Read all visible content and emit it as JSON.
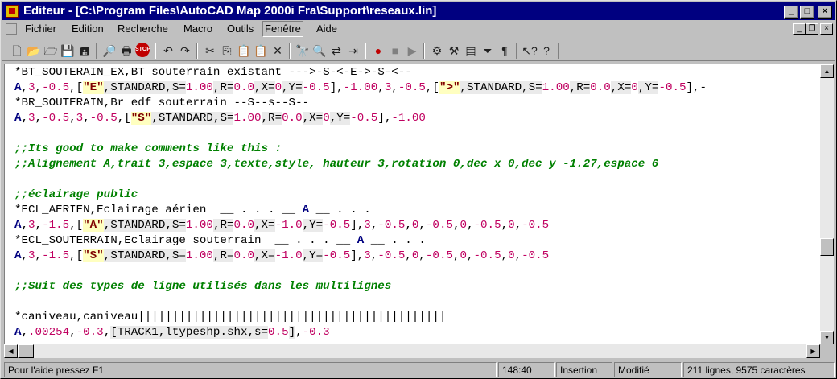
{
  "window": {
    "title": "Editeur - [C:\\Program Files\\AutoCAD Map 2000i Fra\\Support\\reseaux.lin]",
    "minimize": "_",
    "maximize": "□",
    "close": "×"
  },
  "menu": [
    "Fichier",
    "Edition",
    "Recherche",
    "Macro",
    "Outils",
    "Fenêtre",
    "Aide"
  ],
  "mdi": {
    "minimize": "_",
    "restore": "❐",
    "close": "×"
  },
  "toolbar": [
    {
      "name": "new-icon",
      "glyph": "🗋"
    },
    {
      "name": "open-icon",
      "glyph": "📂"
    },
    {
      "name": "open-folder-icon",
      "glyph": "🗁"
    },
    {
      "name": "save-icon",
      "glyph": "💾"
    },
    {
      "name": "save-all-icon",
      "glyph": "🖪"
    },
    {
      "name": "find-file-icon",
      "glyph": "🔎"
    },
    {
      "name": "print-icon",
      "glyph": "🖶"
    },
    {
      "name": "stop-icon",
      "glyph": "STOP"
    },
    {
      "name": "undo-icon",
      "glyph": "↶"
    },
    {
      "name": "redo-icon",
      "glyph": "↷"
    },
    {
      "name": "cut-icon",
      "glyph": "✂"
    },
    {
      "name": "copy-icon",
      "glyph": "⎘"
    },
    {
      "name": "paste-icon",
      "glyph": "📋"
    },
    {
      "name": "paste-special-icon",
      "glyph": "📋"
    },
    {
      "name": "delete-icon",
      "glyph": "✕"
    },
    {
      "name": "find-icon",
      "glyph": "🔭"
    },
    {
      "name": "find-next-icon",
      "glyph": "🔍"
    },
    {
      "name": "replace-icon",
      "glyph": "⇄"
    },
    {
      "name": "goto-icon",
      "glyph": "⇥"
    },
    {
      "name": "record-icon",
      "glyph": "●"
    },
    {
      "name": "stop-record-icon",
      "glyph": "■"
    },
    {
      "name": "play-icon",
      "glyph": "▶"
    },
    {
      "name": "macro-icon",
      "glyph": "⚙"
    },
    {
      "name": "tools-icon",
      "glyph": "⚒"
    },
    {
      "name": "window-icon",
      "glyph": "▤"
    },
    {
      "name": "filter-icon",
      "glyph": "⏷"
    },
    {
      "name": "paragraph-icon",
      "glyph": "¶"
    },
    {
      "name": "context-help-icon",
      "glyph": "↖?"
    },
    {
      "name": "help-icon",
      "glyph": "?"
    }
  ],
  "editor": {
    "lines": [
      [
        [
          "p",
          "*BT_SOUTERAIN_EX,BT souterrain existant --->-S-<-E->-S-<--"
        ]
      ],
      [
        [
          "k",
          "A"
        ],
        [
          "p",
          ","
        ],
        [
          "n",
          "3"
        ],
        [
          "p",
          ","
        ],
        [
          "n",
          "-0.5"
        ],
        [
          "p",
          ",["
        ],
        [
          "s",
          "\"E\""
        ],
        [
          "g",
          ",STANDARD,S="
        ],
        [
          "n",
          "1.00"
        ],
        [
          "g",
          ",R="
        ],
        [
          "n",
          "0.0"
        ],
        [
          "g",
          ",X="
        ],
        [
          "n",
          "0"
        ],
        [
          "g",
          ",Y="
        ],
        [
          "n",
          "-0.5"
        ],
        [
          "p",
          "],"
        ],
        [
          "n",
          "-1.00"
        ],
        [
          "p",
          ","
        ],
        [
          "n",
          "3"
        ],
        [
          "p",
          ","
        ],
        [
          "n",
          "-0.5"
        ],
        [
          "p",
          ",["
        ],
        [
          "s",
          "\">\""
        ],
        [
          "g",
          ",STANDARD,S="
        ],
        [
          "n",
          "1.00"
        ],
        [
          "g",
          ",R="
        ],
        [
          "n",
          "0.0"
        ],
        [
          "g",
          ",X="
        ],
        [
          "n",
          "0"
        ],
        [
          "g",
          ",Y="
        ],
        [
          "n",
          "-0.5"
        ],
        [
          "p",
          "],-"
        ]
      ],
      [
        [
          "p",
          "*BR_SOUTERAIN,Br edf souterrain --S--s--S--"
        ]
      ],
      [
        [
          "k",
          "A"
        ],
        [
          "p",
          ","
        ],
        [
          "n",
          "3"
        ],
        [
          "p",
          ","
        ],
        [
          "n",
          "-0.5"
        ],
        [
          "p",
          ","
        ],
        [
          "n",
          "3"
        ],
        [
          "p",
          ","
        ],
        [
          "n",
          "-0.5"
        ],
        [
          "p",
          ",["
        ],
        [
          "s",
          "\"S\""
        ],
        [
          "g",
          ",STANDARD,S="
        ],
        [
          "n",
          "1.00"
        ],
        [
          "g",
          ",R="
        ],
        [
          "n",
          "0.0"
        ],
        [
          "g",
          ",X="
        ],
        [
          "n",
          "0"
        ],
        [
          "g",
          ",Y="
        ],
        [
          "n",
          "-0.5"
        ],
        [
          "p",
          "],"
        ],
        [
          "n",
          "-1.00"
        ]
      ],
      [
        [
          "p",
          ""
        ]
      ],
      [
        [
          "c",
          ";;Its good to make comments like this :"
        ]
      ],
      [
        [
          "c",
          ";;Alignement A,trait 3,espace 3,texte,style, hauteur 3,rotation 0,dec x 0,dec y -1.27,espace 6"
        ]
      ],
      [
        [
          "p",
          ""
        ]
      ],
      [
        [
          "c",
          ";;éclairage public"
        ]
      ],
      [
        [
          "p",
          "*ECL_AERIEN,Eclairage aérien  __ . . . __ "
        ],
        [
          "k",
          "A"
        ],
        [
          "p",
          " __ . . ."
        ]
      ],
      [
        [
          "k",
          "A"
        ],
        [
          "p",
          ","
        ],
        [
          "n",
          "3"
        ],
        [
          "p",
          ","
        ],
        [
          "n",
          "-1.5"
        ],
        [
          "p",
          ",["
        ],
        [
          "s",
          "\"A\""
        ],
        [
          "g",
          ",STANDARD,S="
        ],
        [
          "n",
          "1.00"
        ],
        [
          "g",
          ",R="
        ],
        [
          "n",
          "0.0"
        ],
        [
          "g",
          ",X="
        ],
        [
          "n",
          "-1.0"
        ],
        [
          "g",
          ",Y="
        ],
        [
          "n",
          "-0.5"
        ],
        [
          "p",
          "],"
        ],
        [
          "n",
          "3"
        ],
        [
          "p",
          ","
        ],
        [
          "n",
          "-0.5"
        ],
        [
          "p",
          ","
        ],
        [
          "n",
          "0"
        ],
        [
          "p",
          ","
        ],
        [
          "n",
          "-0.5"
        ],
        [
          "p",
          ","
        ],
        [
          "n",
          "0"
        ],
        [
          "p",
          ","
        ],
        [
          "n",
          "-0.5"
        ],
        [
          "p",
          ","
        ],
        [
          "n",
          "0"
        ],
        [
          "p",
          ","
        ],
        [
          "n",
          "-0.5"
        ]
      ],
      [
        [
          "p",
          "*ECL_SOUTERRAIN,Eclairage souterrain  __ . . . __ "
        ],
        [
          "k",
          "A"
        ],
        [
          "p",
          " __ . . ."
        ]
      ],
      [
        [
          "k",
          "A"
        ],
        [
          "p",
          ","
        ],
        [
          "n",
          "3"
        ],
        [
          "p",
          ","
        ],
        [
          "n",
          "-1.5"
        ],
        [
          "p",
          ",["
        ],
        [
          "s",
          "\"S\""
        ],
        [
          "g",
          ",STANDARD,S="
        ],
        [
          "n",
          "1.00"
        ],
        [
          "g",
          ",R="
        ],
        [
          "n",
          "0.0"
        ],
        [
          "g",
          ",X="
        ],
        [
          "n",
          "-1.0"
        ],
        [
          "g",
          ",Y="
        ],
        [
          "n",
          "-0.5"
        ],
        [
          "p",
          "],"
        ],
        [
          "n",
          "3"
        ],
        [
          "p",
          ","
        ],
        [
          "n",
          "-0.5"
        ],
        [
          "p",
          ","
        ],
        [
          "n",
          "0"
        ],
        [
          "p",
          ","
        ],
        [
          "n",
          "-0.5"
        ],
        [
          "p",
          ","
        ],
        [
          "n",
          "0"
        ],
        [
          "p",
          ","
        ],
        [
          "n",
          "-0.5"
        ],
        [
          "p",
          ","
        ],
        [
          "n",
          "0"
        ],
        [
          "p",
          ","
        ],
        [
          "n",
          "-0.5"
        ]
      ],
      [
        [
          "p",
          ""
        ]
      ],
      [
        [
          "c",
          ";;Suit des types de ligne utilisés dans les multilignes"
        ]
      ],
      [
        [
          "p",
          ""
        ]
      ],
      [
        [
          "p",
          "*caniveau,caniveau|||||||||||||||||||||||||||||||||||||||||||||"
        ]
      ],
      [
        [
          "k",
          "A"
        ],
        [
          "p",
          ","
        ],
        [
          "n",
          ".00254"
        ],
        [
          "p",
          ","
        ],
        [
          "n",
          "-0.3"
        ],
        [
          "p",
          ","
        ],
        [
          "g",
          "[TRACK1,ltypeshp.shx,s="
        ],
        [
          "n",
          "0.5"
        ],
        [
          "g",
          "]"
        ],
        [
          "p",
          ","
        ],
        [
          "n",
          "-0.3"
        ]
      ]
    ]
  },
  "status": {
    "help": "Pour l'aide pressez F1",
    "position": "148:40",
    "mode": "Insertion",
    "modified": "Modifié",
    "info": "211 lignes, 9575 caractères"
  }
}
